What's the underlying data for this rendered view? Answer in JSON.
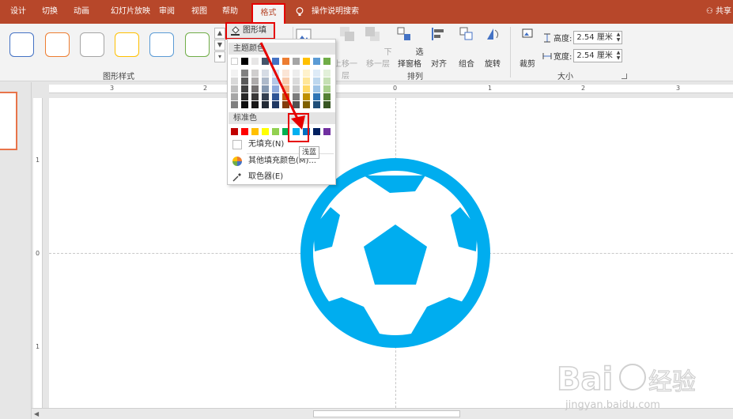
{
  "tabs": [
    {
      "label": "设计"
    },
    {
      "label": "切换"
    },
    {
      "label": "动画"
    },
    {
      "label": "幻灯片放映"
    },
    {
      "label": "审阅"
    },
    {
      "label": "视图"
    },
    {
      "label": "帮助"
    },
    {
      "label": "格式"
    }
  ],
  "tell_me": "操作说明搜索",
  "share": "共享",
  "ribbon": {
    "shape_styles_label": "图形样式",
    "shape_style_colors": [
      "#4472c4",
      "#ed7d31",
      "#a5a5a5",
      "#ffc000",
      "#5b9bd5",
      "#70ad47"
    ],
    "shape_fill": "图形填充",
    "bring_forward": "上移一层",
    "send_backward": "下移一层",
    "selection_pane": "选择窗格",
    "align": "对齐",
    "group": "组合",
    "rotate": "旋转",
    "arrange_label": "排列",
    "crop": "裁剪",
    "height_label": "高度:",
    "height_value": "2.54 厘米",
    "width_label": "宽度:",
    "width_value": "2.54 厘米",
    "size_label": "大小"
  },
  "dropdown": {
    "theme_colors_label": "主题颜色",
    "standard_colors_label": "标准色",
    "no_fill": "无填充(N)",
    "more_colors": "其他填充颜色(M)...",
    "eyedropper": "取色器(E)",
    "theme_top": [
      "#ffffff",
      "#000000",
      "#e7e6e6",
      "#44546a",
      "#4472c4",
      "#ed7d31",
      "#a5a5a5",
      "#ffc000",
      "#5b9bd5",
      "#70ad47"
    ],
    "theme_shades": [
      [
        "#f2f2f2",
        "#808080",
        "#d0cece",
        "#d6dce5",
        "#dae3f3",
        "#fbe5d6",
        "#ededed",
        "#fff2cc",
        "#deebf7",
        "#e2f0d9"
      ],
      [
        "#d9d9d9",
        "#595959",
        "#aeabab",
        "#adb9ca",
        "#b4c7e7",
        "#f8cbad",
        "#dbdbdb",
        "#ffe699",
        "#bdd7ee",
        "#c5e0b4"
      ],
      [
        "#bfbfbf",
        "#404040",
        "#757171",
        "#8497b0",
        "#8faadc",
        "#f4b183",
        "#c9c9c9",
        "#ffd966",
        "#9dc3e6",
        "#a9d18e"
      ],
      [
        "#a6a6a6",
        "#262626",
        "#3a3838",
        "#333f50",
        "#2f5597",
        "#c55a11",
        "#7b7b7b",
        "#bf9000",
        "#2e75b6",
        "#548235"
      ],
      [
        "#7f7f7f",
        "#0d0d0d",
        "#171616",
        "#222a35",
        "#1f3864",
        "#843c0c",
        "#525252",
        "#7f6000",
        "#1f4e79",
        "#375623"
      ]
    ],
    "standard": [
      "#c00000",
      "#ff0000",
      "#ffc000",
      "#ffff00",
      "#92d050",
      "#00b050",
      "#00b0f0",
      "#0070c0",
      "#002060",
      "#7030a0"
    ],
    "tooltip": "浅蓝"
  },
  "ruler": {
    "h_labels": [
      "3",
      "2",
      "0",
      "1",
      "2",
      "3"
    ],
    "v_labels": [
      "1",
      "0",
      "1"
    ]
  },
  "shape": {
    "fill": "#00adef"
  },
  "watermark": {
    "brand": "Baidu经验",
    "url": "jingyan.baidu.com"
  }
}
